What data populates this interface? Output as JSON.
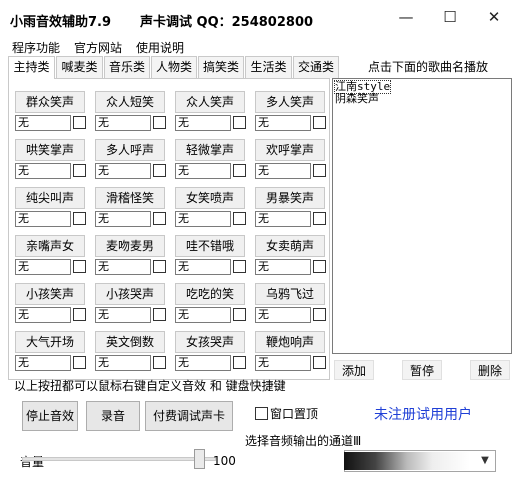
{
  "window": {
    "title": "小雨音效辅助7.9",
    "subtitle": "声卡调试 QQ：254802800",
    "controls": {
      "minimize": "—",
      "maximize": "☐",
      "close": "✕"
    }
  },
  "menu": [
    "程序功能",
    "官方网站",
    "使用说明"
  ],
  "tabs": [
    "主持类",
    "喊麦类",
    "音乐类",
    "人物类",
    "搞笑类",
    "生活类",
    "交通类"
  ],
  "active_tab": "主持类",
  "sound_buttons": [
    {
      "label": "群众笑声",
      "hotkey": "无"
    },
    {
      "label": "众人短笑",
      "hotkey": "无"
    },
    {
      "label": "众人笑声",
      "hotkey": "无"
    },
    {
      "label": "多人笑声",
      "hotkey": "无"
    },
    {
      "label": "哄笑掌声",
      "hotkey": "无"
    },
    {
      "label": "多人呼声",
      "hotkey": "无"
    },
    {
      "label": "轻微掌声",
      "hotkey": "无"
    },
    {
      "label": "欢呼掌声",
      "hotkey": "无"
    },
    {
      "label": "纯尖叫声",
      "hotkey": "无"
    },
    {
      "label": "滑稽怪笑",
      "hotkey": "无"
    },
    {
      "label": "女笑喷声",
      "hotkey": "无"
    },
    {
      "label": "男暴笑声",
      "hotkey": "无"
    },
    {
      "label": "亲嘴声女",
      "hotkey": "无"
    },
    {
      "label": "麦吻麦男",
      "hotkey": "无"
    },
    {
      "label": "哇不错哦",
      "hotkey": "无"
    },
    {
      "label": "女卖萌声",
      "hotkey": "无"
    },
    {
      "label": "小孩笑声",
      "hotkey": "无"
    },
    {
      "label": "小孩哭声",
      "hotkey": "无"
    },
    {
      "label": "吃吃的笑",
      "hotkey": "无"
    },
    {
      "label": "乌鸦飞过",
      "hotkey": "无"
    },
    {
      "label": "大气开场",
      "hotkey": "无"
    },
    {
      "label": "英文倒数",
      "hotkey": "无"
    },
    {
      "label": "女孩哭声",
      "hotkey": "无"
    },
    {
      "label": "鞭炮响声",
      "hotkey": "无"
    }
  ],
  "playlist": {
    "header": "点击下面的歌曲名播放",
    "items": [
      "江南style",
      "阴森笑声"
    ],
    "add": "添加",
    "pause": "暂停",
    "delete": "删除"
  },
  "hint": "以上按扭都可以鼠标右键自定义音效 和 键盘快捷键",
  "bottom": {
    "stop_button": "停止音效",
    "record_button": "录音",
    "paid_button": "付费调试声卡",
    "topmost_label": "窗口置顶",
    "unregistered": "未注册试用用户",
    "output_label": "选择音频输出的通道Ⅲ",
    "volume_label": "音量",
    "volume_value": "100",
    "volume_level": 100
  }
}
